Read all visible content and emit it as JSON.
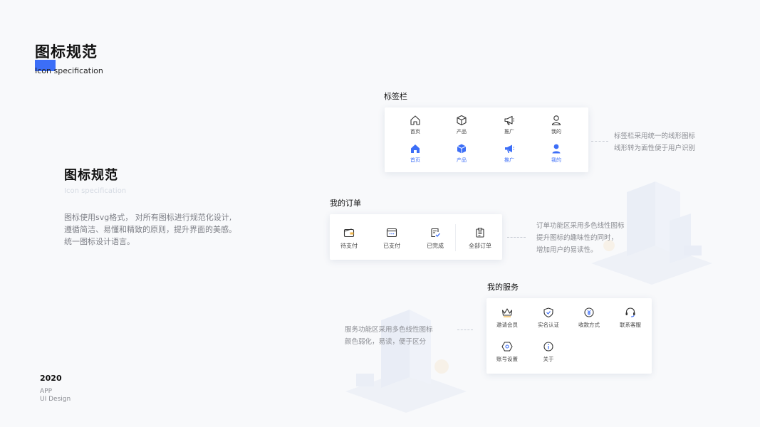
{
  "header": {
    "title": "图标规范",
    "subtitle": "Icon specification"
  },
  "intro": {
    "title": "图标规范",
    "subtitle": "Icon specification",
    "lines": [
      "图标使用svg格式， 对所有图标进行规范化设计,",
      "遵循简洁、易懂和精致的原则，提升界面的美感。",
      "统一图标设计语言。"
    ]
  },
  "footer": {
    "year": "2020",
    "line1": "APP",
    "line2": "UI  Design"
  },
  "tabbar": {
    "label": "标签栏",
    "items": [
      {
        "label": "首页",
        "icon": "home-icon"
      },
      {
        "label": "产品",
        "icon": "cube-icon"
      },
      {
        "label": "推广",
        "icon": "megaphone-icon"
      },
      {
        "label": "我的",
        "icon": "user-icon"
      }
    ],
    "note": [
      "标签栏采用统一的线形图标",
      "线形转为面性便于用户识别"
    ]
  },
  "orders": {
    "label": "我的订单",
    "items": [
      {
        "label": "待支付",
        "icon": "wallet-icon"
      },
      {
        "label": "已支付",
        "icon": "card-icon"
      },
      {
        "label": "已完成",
        "icon": "checklist-icon"
      },
      {
        "label": "全部订单",
        "icon": "clipboard-icon"
      }
    ],
    "note": [
      "订单功能区采用多色线性图标",
      "提升图标的趣味性的同时，",
      "增加用户的易读性。"
    ]
  },
  "services": {
    "label": "我的服务",
    "items": [
      {
        "label": "邀请会员",
        "icon": "crown-icon"
      },
      {
        "label": "实名认证",
        "icon": "shield-check-icon"
      },
      {
        "label": "收款方式",
        "icon": "coin-icon"
      },
      {
        "label": "联系客服",
        "icon": "headset-icon"
      },
      {
        "label": "账号设置",
        "icon": "settings-hexagon-icon"
      },
      {
        "label": "关于",
        "icon": "info-icon"
      }
    ],
    "note": [
      "服务功能区采用多色线性图标",
      "颜色弱化，易读，便于区分"
    ]
  },
  "colors": {
    "accent": "#3c6ef7",
    "text": "#222222",
    "muted": "#8a8c92",
    "background": "#f8f9fb"
  }
}
